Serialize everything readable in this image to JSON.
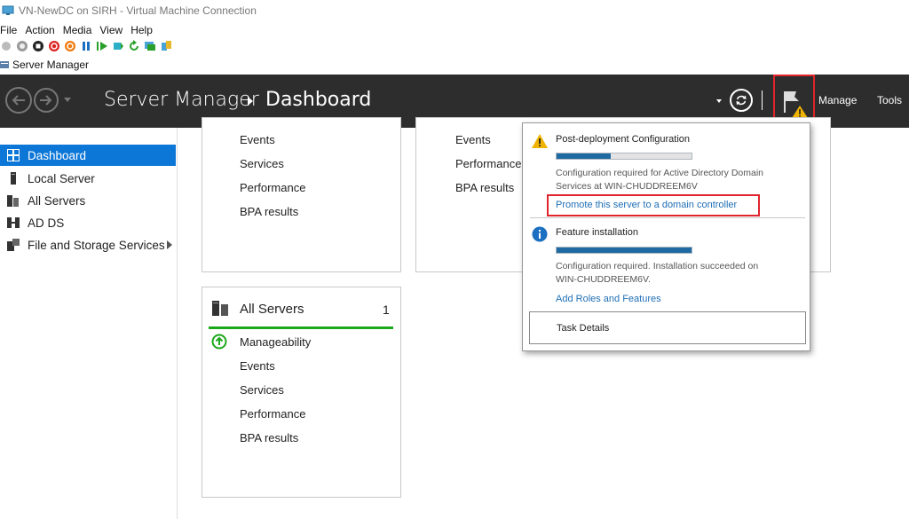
{
  "vm": {
    "title": "VN-NewDC on SIRH - Virtual Machine Connection",
    "menu": [
      "File",
      "Action",
      "Media",
      "View",
      "Help"
    ],
    "toolbar_icons": [
      "ctrl-alt-del-icon",
      "start-icon",
      "turn-off-icon",
      "shutdown-icon",
      "save-icon",
      "pause-icon",
      "resume-icon",
      "checkpoint-icon",
      "revert-icon",
      "enhanced-session-icon",
      "share-icon"
    ]
  },
  "app": {
    "window_title": "Server Manager",
    "title": "Server Manager",
    "page": "Dashboard",
    "manage": "Manage",
    "tools": "Tools"
  },
  "sidebar": {
    "items": [
      {
        "label": "Dashboard",
        "icon": "dashboard-icon",
        "active": true
      },
      {
        "label": "Local Server",
        "icon": "local-server-icon"
      },
      {
        "label": "All Servers",
        "icon": "all-servers-icon"
      },
      {
        "label": "AD DS",
        "icon": "ad-ds-icon"
      },
      {
        "label": "File and Storage Services",
        "icon": "file-storage-icon",
        "has_arrow": true
      }
    ]
  },
  "tiles": {
    "top_left": [
      "Events",
      "Services",
      "Performance",
      "BPA results"
    ],
    "top_right": [
      "Events",
      "Performance",
      "BPA results"
    ],
    "all_servers": {
      "title": "All Servers",
      "count": "1",
      "rows": [
        "Manageability",
        "Events",
        "Services",
        "Performance",
        "BPA results"
      ]
    }
  },
  "notifications": {
    "post_deploy": {
      "title": "Post-deployment Configuration",
      "progress": 0.4,
      "line1": "Configuration required for Active Directory Domain",
      "line2": "Services at WIN-CHUDDREEM6V",
      "link": "Promote this server to a domain controller"
    },
    "feature": {
      "title": "Feature installation",
      "progress": 1.0,
      "line1": "Configuration required. Installation succeeded on",
      "line2": "WIN-CHUDDREEM6V.",
      "link": "Add Roles and Features"
    },
    "task_details": "Task Details"
  },
  "colors": {
    "header_bg": "#2d2d2d",
    "active_item": "#0d77d8",
    "link": "#1f6fb5",
    "highlight_box": "#e0242b",
    "status_green": "#1ba91b",
    "warning": "#f0b400"
  }
}
